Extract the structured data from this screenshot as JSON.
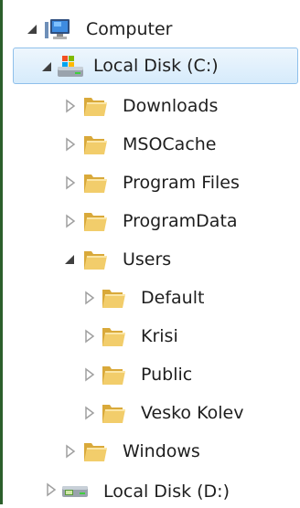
{
  "tree": {
    "items": [
      {
        "label": "Computer",
        "expanded": true,
        "icon": "computer-icon"
      },
      {
        "label": "Local Disk (C:)",
        "expanded": true,
        "selected": true,
        "icon": "local-disk-icon"
      },
      {
        "label": "Downloads",
        "expanded": false,
        "icon": "folder-icon"
      },
      {
        "label": "MSOCache",
        "expanded": false,
        "icon": "folder-icon"
      },
      {
        "label": "Program Files",
        "expanded": false,
        "icon": "folder-icon"
      },
      {
        "label": "ProgramData",
        "expanded": false,
        "icon": "folder-icon"
      },
      {
        "label": "Users",
        "expanded": true,
        "icon": "folder-icon"
      },
      {
        "label": "Default",
        "expanded": false,
        "icon": "folder-icon"
      },
      {
        "label": "Krisi",
        "expanded": false,
        "icon": "folder-icon"
      },
      {
        "label": "Public",
        "expanded": false,
        "icon": "folder-icon"
      },
      {
        "label": "Vesko Kolev",
        "expanded": false,
        "icon": "folder-icon"
      },
      {
        "label": "Windows",
        "expanded": false,
        "icon": "folder-icon"
      },
      {
        "label": "Local Disk (D:)",
        "expanded": false,
        "icon": "local-disk-icon"
      }
    ]
  },
  "colors": {
    "selection_background": "#d6ebfb",
    "selection_border": "#8fc0eb",
    "folder": "#e8b84a",
    "text": "#1e1e1e",
    "left_border": "#2b5f2b"
  }
}
